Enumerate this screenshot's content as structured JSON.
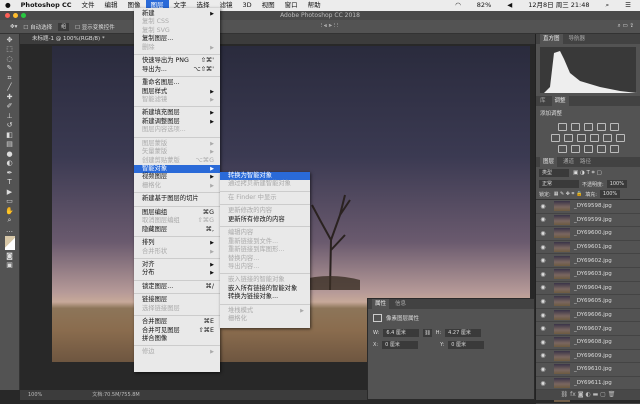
{
  "menubar": {
    "apple": "",
    "app": "Photoshop CC",
    "items": [
      "文件",
      "编辑",
      "图像",
      "图层",
      "文字",
      "选择",
      "滤镜",
      "3D",
      "视图",
      "窗口",
      "帮助"
    ],
    "active": "图层",
    "status": {
      "battery": "82%",
      "datetime": "12月8日 周三 21:48"
    }
  },
  "window": {
    "title": "Adobe Photoshop CC 2018"
  },
  "options": {
    "auto_select": "自动选择",
    "auto_select_target": "组",
    "show_transform": "显示变换控件"
  },
  "document": {
    "tab": "未标题-1 @ 100%(RGB/8) *",
    "zoom": "100%",
    "doc_info": "文档:70.5M/755.8M"
  },
  "layer_menu": [
    {
      "label": "新建",
      "sub": true
    },
    {
      "label": "复制 CSS",
      "dis": true
    },
    {
      "label": "复制 SVG",
      "dis": true
    },
    {
      "label": "复制图层..."
    },
    {
      "label": "删除",
      "sub": true,
      "dis": true
    },
    {
      "sep": true
    },
    {
      "label": "快速导出为 PNG",
      "key": "⇧⌘'"
    },
    {
      "label": "导出为...",
      "key": "⌥⇧⌘'"
    },
    {
      "sep": true
    },
    {
      "label": "重命名图层..."
    },
    {
      "label": "图层样式",
      "sub": true
    },
    {
      "label": "智能滤镜",
      "sub": true,
      "dis": true
    },
    {
      "sep": true
    },
    {
      "label": "新建填充图层",
      "sub": true
    },
    {
      "label": "新建调整图层",
      "sub": true
    },
    {
      "label": "图层内容选项...",
      "dis": true
    },
    {
      "sep": true
    },
    {
      "label": "图层蒙版",
      "sub": true,
      "dis": true
    },
    {
      "label": "矢量蒙版",
      "sub": true,
      "dis": true
    },
    {
      "label": "创建剪贴蒙版",
      "key": "⌥⌘G",
      "dis": true
    },
    {
      "label": "智能对象",
      "sub": true,
      "hl": true
    },
    {
      "label": "视频图层",
      "sub": true
    },
    {
      "label": "栅格化",
      "sub": true,
      "dis": true
    },
    {
      "sep": true
    },
    {
      "label": "新建基于图层的切片"
    },
    {
      "sep": true
    },
    {
      "label": "图层编组",
      "key": "⌘G"
    },
    {
      "label": "取消图层编组",
      "key": "⇧⌘G",
      "dis": true
    },
    {
      "label": "隐藏图层",
      "key": "⌘,"
    },
    {
      "sep": true
    },
    {
      "label": "排列",
      "sub": true
    },
    {
      "label": "合并形状",
      "sub": true,
      "dis": true
    },
    {
      "sep": true
    },
    {
      "label": "对齐",
      "sub": true
    },
    {
      "label": "分布",
      "sub": true
    },
    {
      "sep": true
    },
    {
      "label": "锁定图层...",
      "key": "⌘/"
    },
    {
      "sep": true
    },
    {
      "label": "链接图层"
    },
    {
      "label": "选择链接图层",
      "dis": true
    },
    {
      "sep": true
    },
    {
      "label": "合并图层",
      "key": "⌘E"
    },
    {
      "label": "合并可见图层",
      "key": "⇧⌘E"
    },
    {
      "label": "拼合图像"
    },
    {
      "sep": true
    },
    {
      "label": "修边",
      "sub": true,
      "dis": true
    }
  ],
  "smart_object_menu": [
    {
      "label": "转换为智能对象",
      "hl": true
    },
    {
      "label": "通过拷贝新建智能对象",
      "dis": true
    },
    {
      "sep": true
    },
    {
      "label": "在 Finder 中显示",
      "dis": true
    },
    {
      "sep": true
    },
    {
      "label": "更新修改的内容",
      "dis": true
    },
    {
      "label": "更新所有修改的内容"
    },
    {
      "sep": true
    },
    {
      "label": "编辑内容",
      "dis": true
    },
    {
      "label": "重新链接到文件...",
      "dis": true
    },
    {
      "label": "重新链接到库图形...",
      "dis": true
    },
    {
      "label": "替换内容...",
      "dis": true
    },
    {
      "label": "导出内容...",
      "dis": true
    },
    {
      "sep": true
    },
    {
      "label": "嵌入链接的智能对象",
      "dis": true
    },
    {
      "label": "嵌入所有链接的智能对象"
    },
    {
      "label": "转换为链接对象..."
    },
    {
      "sep": true
    },
    {
      "label": "堆栈模式",
      "sub": true,
      "dis": true
    },
    {
      "label": "栅格化",
      "dis": true
    }
  ],
  "panels": {
    "histogram_tabs": [
      "直方图",
      "导航器"
    ],
    "adjust_tabs": [
      "库",
      "调整"
    ],
    "adjust_title": "添加调整",
    "layers_tabs": [
      "图层",
      "通道",
      "路径"
    ],
    "kind": "类型",
    "blend": "正常",
    "opacity_label": "不透明度:",
    "opacity": "100%",
    "lock_label": "锁定:",
    "fill_label": "填充:",
    "fill": "100%",
    "layers": [
      "_DY69598.jpg",
      "_DY69599.jpg",
      "_DY69600.jpg",
      "_DY69601.jpg",
      "_DY69602.jpg",
      "_DY69603.jpg",
      "_DY69604.jpg",
      "_DY69605.jpg",
      "_DY69606.jpg",
      "_DY69607.jpg",
      "_DY69608.jpg",
      "_DY69609.jpg",
      "_DY69610.jpg",
      "_DY69611.jpg",
      "_DY69612.jpg"
    ]
  },
  "properties": {
    "tabs": [
      "属性",
      "信息"
    ],
    "type": "像素图层属性",
    "w_label": "W:",
    "w": "6.4 厘米",
    "h_label": "H:",
    "h": "4.27 厘米",
    "x_label": "X:",
    "x": "0 厘米",
    "y_label": "Y:",
    "y": "0 厘米"
  },
  "colors": {
    "accent": "#2a6ad8",
    "menu_bg": "#e9e9e9",
    "panel": "#535353"
  }
}
